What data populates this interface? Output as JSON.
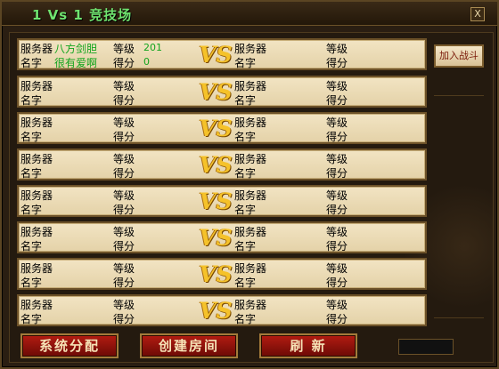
{
  "window": {
    "title": "1 Vs 1 竞技场",
    "close_label": "X"
  },
  "labels": {
    "server": "服务器",
    "level": "等级",
    "name": "名字",
    "score": "得分",
    "vs": "VS"
  },
  "rows": [
    {
      "left": {
        "server": "八方剑胆",
        "level": "201",
        "name": "很有爱啊",
        "score": "0"
      },
      "right": {
        "server": "",
        "level": "",
        "name": "",
        "score": ""
      }
    },
    {
      "left": {
        "server": "",
        "level": "",
        "name": "",
        "score": ""
      },
      "right": {
        "server": "",
        "level": "",
        "name": "",
        "score": ""
      }
    },
    {
      "left": {
        "server": "",
        "level": "",
        "name": "",
        "score": ""
      },
      "right": {
        "server": "",
        "level": "",
        "name": "",
        "score": ""
      }
    },
    {
      "left": {
        "server": "",
        "level": "",
        "name": "",
        "score": ""
      },
      "right": {
        "server": "",
        "level": "",
        "name": "",
        "score": ""
      }
    },
    {
      "left": {
        "server": "",
        "level": "",
        "name": "",
        "score": ""
      },
      "right": {
        "server": "",
        "level": "",
        "name": "",
        "score": ""
      }
    },
    {
      "left": {
        "server": "",
        "level": "",
        "name": "",
        "score": ""
      },
      "right": {
        "server": "",
        "level": "",
        "name": "",
        "score": ""
      }
    },
    {
      "left": {
        "server": "",
        "level": "",
        "name": "",
        "score": ""
      },
      "right": {
        "server": "",
        "level": "",
        "name": "",
        "score": ""
      }
    },
    {
      "left": {
        "server": "",
        "level": "",
        "name": "",
        "score": ""
      },
      "right": {
        "server": "",
        "level": "",
        "name": "",
        "score": ""
      }
    }
  ],
  "buttons": {
    "join": "加入战斗",
    "assign": "系统分配",
    "create_room": "创建房间",
    "refresh": "刷  新"
  }
}
